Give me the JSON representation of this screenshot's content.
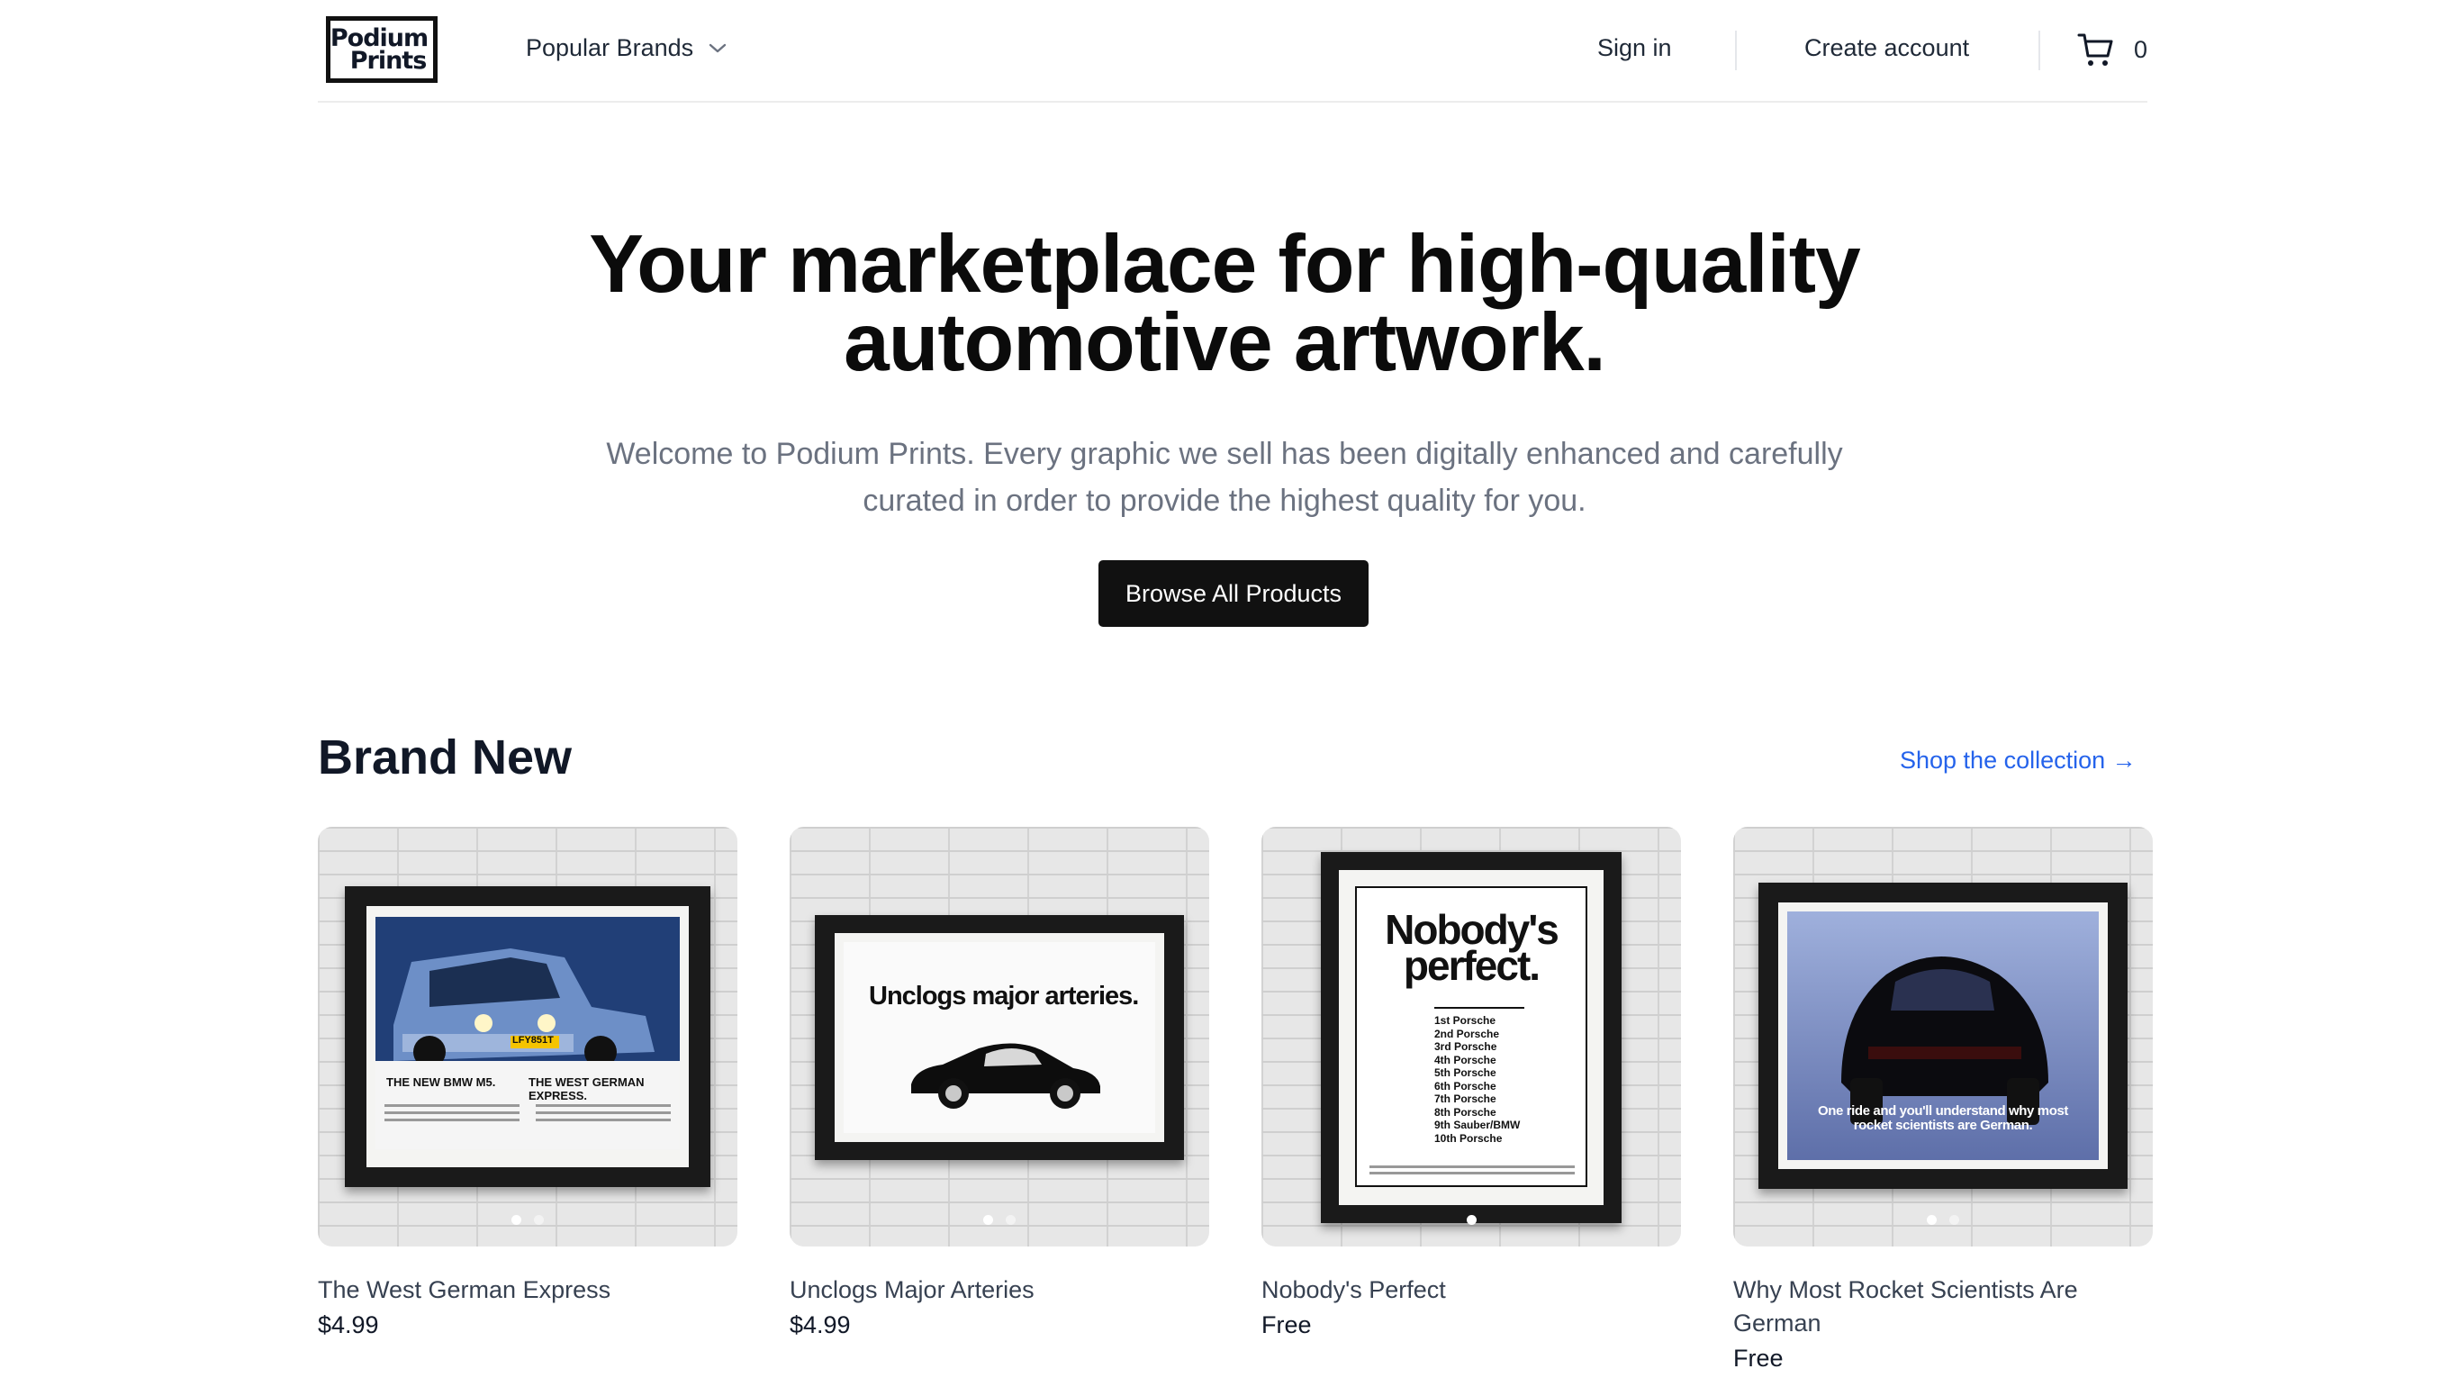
{
  "header": {
    "logo_line1": "Podium",
    "logo_line2": "Prints",
    "brands_label": "Popular Brands",
    "signin_label": "Sign in",
    "create_label": "Create account",
    "cart_count": "0"
  },
  "hero": {
    "title": "Your marketplace for high-quality automotive artwork.",
    "subtitle": "Welcome to Podium Prints. Every graphic we sell has been digitally enhanced and carefully curated in order to provide the highest quality for you.",
    "cta_label": "Browse All Products"
  },
  "section": {
    "title": "Brand New",
    "link_label": "Shop the collection →"
  },
  "products": [
    {
      "name": "The West German Express",
      "price": "$4.99",
      "ad_text_left": "THE NEW BMW M5.",
      "ad_text_right": "THE WEST GERMAN EXPRESS.",
      "plate": "LFY851T"
    },
    {
      "name": "Unclogs Major Arteries",
      "price": "$4.99",
      "ad_headline": "Unclogs major arteries."
    },
    {
      "name": "Nobody's Perfect",
      "price": "Free",
      "ad_headline_1": "Nobody's",
      "ad_headline_2": "perfect.",
      "ranking": [
        "1st Porsche",
        "2nd Porsche",
        "3rd Porsche",
        "4th Porsche",
        "5th Porsche",
        "6th Porsche",
        "7th Porsche",
        "8th Porsche",
        "9th Sauber/BMW",
        "10th Porsche"
      ]
    },
    {
      "name": "Why Most Rocket Scientists Are German",
      "price": "Free",
      "ad_caption_1": "One ride and you'll understand why most",
      "ad_caption_2": "rocket scientists are German."
    }
  ],
  "colors": {
    "primary_button": "#111111",
    "link": "#2563eb",
    "muted_text": "#6b7280"
  },
  "icons": {
    "brands_chevron": "chevron-down-icon",
    "cart": "shopping-cart-icon"
  }
}
